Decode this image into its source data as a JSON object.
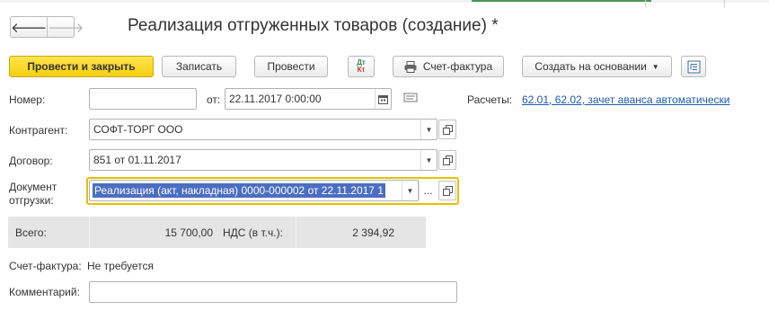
{
  "title": "Реализация отгруженных товаров (создание) *",
  "nav": {
    "back_icon": "arrow-left-icon",
    "forward_icon": "arrow-right-icon",
    "back_glyph": "🡐",
    "forward_glyph": "🡒"
  },
  "toolbar": {
    "post_close": "Провести и закрыть",
    "save": "Записать",
    "post": "Провести",
    "dt_kt_top": "Дт",
    "dt_kt_bottom": "Кт",
    "invoice": "Счет-фактура",
    "create_based": "Создать на основании"
  },
  "form": {
    "number_label": "Номер:",
    "number_value": "",
    "date_label": "от:",
    "date_value": "22.11.2017  0:00:00",
    "settlements_label": "Расчеты:",
    "settlements_link": "62.01, 62.02, зачет аванса автоматически",
    "counterparty_label": "Контрагент:",
    "counterparty_value": "СОФТ-ТОРГ ООО",
    "contract_label": "Договор:",
    "contract_value": "851 от 01.11.2017",
    "shipment_label_line1": "Документ",
    "shipment_label_line2": "отгрузки:",
    "shipment_value": "Реализация (акт, накладная) 0000-000002 от 22.11.2017 1",
    "select_ellipsis": "...",
    "total_label": "Всего:",
    "total_value": "15 700,00",
    "vat_label": "НДС (в т.ч.):",
    "vat_value": "2 394,92",
    "invoice_label": "Счет-фактура:",
    "invoice_value": "Не требуется",
    "comment_label": "Комментарий:",
    "comment_value": ""
  },
  "colors": {
    "primary": "#f5cf0d",
    "link": "#1e5aa8",
    "selection": "#4b6ec1",
    "focus": "#e6c100"
  }
}
